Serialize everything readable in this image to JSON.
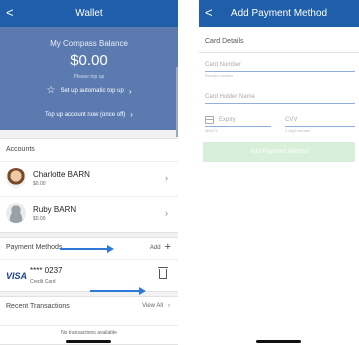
{
  "wallet": {
    "back_glyph": "<",
    "title": "Wallet",
    "balance_label": "My Compass Balance",
    "balance_amount": "$0.00",
    "balance_hint": "Please top up",
    "auto_topup_label": "Set up automatic top up",
    "topup_now_label": "Top up account now (once off)",
    "accounts_header": "Accounts",
    "accounts": [
      {
        "name": "Charlotte  BARN",
        "balance": "$0.00",
        "avatar": "girl-avatar"
      },
      {
        "name": "Ruby  BARN",
        "balance": "$0.00",
        "avatar": "generic-person-avatar"
      }
    ],
    "payment_methods_header": "Payment Methods",
    "add_label": "Add",
    "payment_method": {
      "brand": "VISA",
      "number": "**** 0237",
      "type": "Credit Card"
    },
    "recent_header": "Recent Transactions",
    "view_all_label": "View All",
    "no_transactions": "No transactions available"
  },
  "add_payment": {
    "back_glyph": "<",
    "title": "Add Payment Method",
    "card_details_header": "Card Details",
    "card_number_placeholder": "Card Number",
    "card_number_hint": "Receipt number",
    "holder_placeholder": "Card Holder Name",
    "expiry_placeholder": "Expiry",
    "expiry_hint": "MM/YY",
    "cvv_placeholder": "CVV",
    "cvv_hint": "3 digit number",
    "submit_label": "Add Payment Method"
  },
  "icons": {
    "star": "star-outline-icon",
    "chevron": "chevron-right-icon",
    "plus": "plus-icon",
    "trash": "trash-icon",
    "calendar": "calendar-icon",
    "annotation_arrows": "blue-arrow"
  },
  "colors": {
    "header_blue": "#1f5ea8",
    "balance_panel": "#5b7bb0",
    "annotation_arrow": "#2f78d8",
    "visa_blue": "#1a3f8f",
    "disabled_button": "#d8efd9"
  }
}
